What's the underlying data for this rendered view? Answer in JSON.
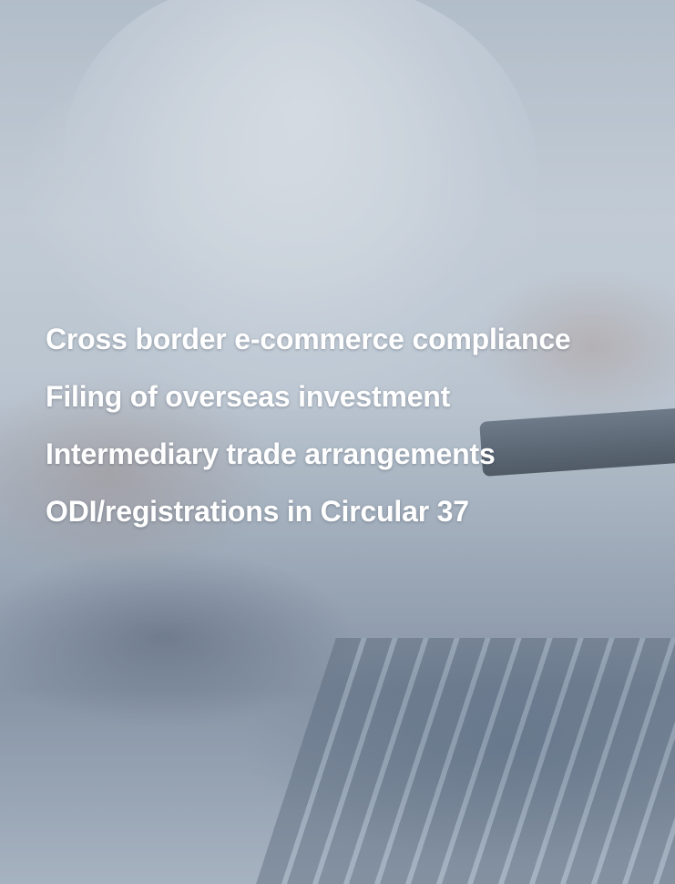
{
  "services": [
    "Cross border e-commerce compliance",
    "Filing of overseas investment",
    "Intermediary trade arrangements",
    "ODI/registrations in Circular 37"
  ],
  "colors": {
    "text": "#ffffff",
    "overlay": "#788799"
  }
}
